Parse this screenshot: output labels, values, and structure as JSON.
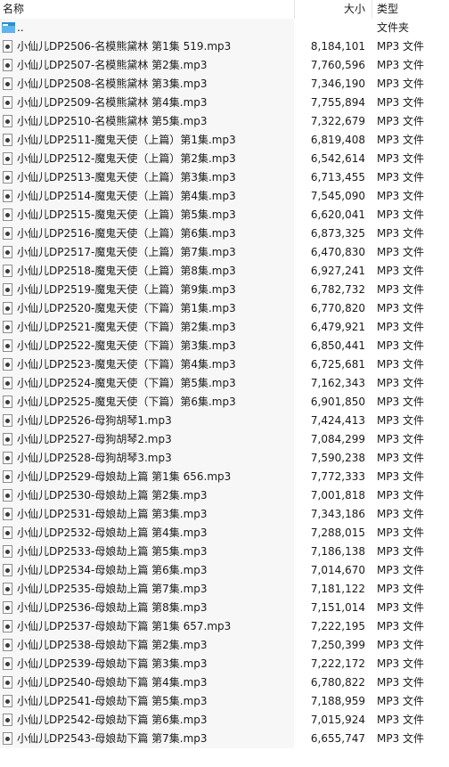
{
  "columns": {
    "name": "名称",
    "size": "大小",
    "type": "类型",
    "sort_indicator": "^"
  },
  "parent_row": {
    "name": "..",
    "size": "",
    "type": "文件夹",
    "icon": "folder-icon"
  },
  "files": [
    {
      "name": "小仙儿DP2506-名模熊黛林 第1集 519.mp3",
      "size": "8,184,101",
      "type": "MP3 文件"
    },
    {
      "name": "小仙儿DP2507-名模熊黛林 第2集.mp3",
      "size": "7,760,596",
      "type": "MP3 文件"
    },
    {
      "name": "小仙儿DP2508-名模熊黛林 第3集.mp3",
      "size": "7,346,190",
      "type": "MP3 文件"
    },
    {
      "name": "小仙儿DP2509-名模熊黛林 第4集.mp3",
      "size": "7,755,894",
      "type": "MP3 文件"
    },
    {
      "name": "小仙儿DP2510-名模熊黛林 第5集.mp3",
      "size": "7,322,679",
      "type": "MP3 文件"
    },
    {
      "name": "小仙儿DP2511-魔鬼天使（上篇）第1集.mp3",
      "size": "6,819,408",
      "type": "MP3 文件"
    },
    {
      "name": "小仙儿DP2512-魔鬼天使（上篇）第2集.mp3",
      "size": "6,542,614",
      "type": "MP3 文件"
    },
    {
      "name": "小仙儿DP2513-魔鬼天使（上篇）第3集.mp3",
      "size": "6,713,455",
      "type": "MP3 文件"
    },
    {
      "name": "小仙儿DP2514-魔鬼天使（上篇）第4集.mp3",
      "size": "7,545,090",
      "type": "MP3 文件"
    },
    {
      "name": "小仙儿DP2515-魔鬼天使（上篇）第5集.mp3",
      "size": "6,620,041",
      "type": "MP3 文件"
    },
    {
      "name": "小仙儿DP2516-魔鬼天使（上篇）第6集.mp3",
      "size": "6,873,325",
      "type": "MP3 文件"
    },
    {
      "name": "小仙儿DP2517-魔鬼天使（上篇）第7集.mp3",
      "size": "6,470,830",
      "type": "MP3 文件"
    },
    {
      "name": "小仙儿DP2518-魔鬼天使（上篇）第8集.mp3",
      "size": "6,927,241",
      "type": "MP3 文件"
    },
    {
      "name": "小仙儿DP2519-魔鬼天使（上篇）第9集.mp3",
      "size": "6,782,732",
      "type": "MP3 文件"
    },
    {
      "name": "小仙儿DP2520-魔鬼天使（下篇）第1集.mp3",
      "size": "6,770,820",
      "type": "MP3 文件"
    },
    {
      "name": "小仙儿DP2521-魔鬼天使（下篇）第2集.mp3",
      "size": "6,479,921",
      "type": "MP3 文件"
    },
    {
      "name": "小仙儿DP2522-魔鬼天使（下篇）第3集.mp3",
      "size": "6,850,441",
      "type": "MP3 文件"
    },
    {
      "name": "小仙儿DP2523-魔鬼天使（下篇）第4集.mp3",
      "size": "6,725,681",
      "type": "MP3 文件"
    },
    {
      "name": "小仙儿DP2524-魔鬼天使（下篇）第5集.mp3",
      "size": "7,162,343",
      "type": "MP3 文件"
    },
    {
      "name": "小仙儿DP2525-魔鬼天使（下篇）第6集.mp3",
      "size": "6,901,850",
      "type": "MP3 文件"
    },
    {
      "name": "小仙儿DP2526-母狗胡琴1.mp3",
      "size": "7,424,413",
      "type": "MP3 文件"
    },
    {
      "name": "小仙儿DP2527-母狗胡琴2.mp3",
      "size": "7,084,299",
      "type": "MP3 文件"
    },
    {
      "name": "小仙儿DP2528-母狗胡琴3.mp3",
      "size": "7,590,238",
      "type": "MP3 文件"
    },
    {
      "name": "小仙儿DP2529-母娘劫上篇 第1集 656.mp3",
      "size": "7,772,333",
      "type": "MP3 文件"
    },
    {
      "name": "小仙儿DP2530-母娘劫上篇 第2集.mp3",
      "size": "7,001,818",
      "type": "MP3 文件"
    },
    {
      "name": "小仙儿DP2531-母娘劫上篇 第3集.mp3",
      "size": "7,343,186",
      "type": "MP3 文件"
    },
    {
      "name": "小仙儿DP2532-母娘劫上篇 第4集.mp3",
      "size": "7,288,015",
      "type": "MP3 文件"
    },
    {
      "name": "小仙儿DP2533-母娘劫上篇 第5集.mp3",
      "size": "7,186,138",
      "type": "MP3 文件"
    },
    {
      "name": "小仙儿DP2534-母娘劫上篇 第6集.mp3",
      "size": "7,014,670",
      "type": "MP3 文件"
    },
    {
      "name": "小仙儿DP2535-母娘劫上篇 第7集.mp3",
      "size": "7,181,122",
      "type": "MP3 文件"
    },
    {
      "name": "小仙儿DP2536-母娘劫上篇 第8集.mp3",
      "size": "7,151,014",
      "type": "MP3 文件"
    },
    {
      "name": "小仙儿DP2537-母娘劫下篇 第1集 657.mp3",
      "size": "7,222,195",
      "type": "MP3 文件"
    },
    {
      "name": "小仙儿DP2538-母娘劫下篇 第2集.mp3",
      "size": "7,250,399",
      "type": "MP3 文件"
    },
    {
      "name": "小仙儿DP2539-母娘劫下篇 第3集.mp3",
      "size": "7,222,172",
      "type": "MP3 文件"
    },
    {
      "name": "小仙儿DP2540-母娘劫下篇 第4集.mp3",
      "size": "6,780,822",
      "type": "MP3 文件"
    },
    {
      "name": "小仙儿DP2541-母娘劫下篇 第5集.mp3",
      "size": "7,188,959",
      "type": "MP3 文件"
    },
    {
      "name": "小仙儿DP2542-母娘劫下篇 第6集.mp3",
      "size": "7,015,924",
      "type": "MP3 文件"
    },
    {
      "name": "小仙儿DP2543-母娘劫下篇 第7集.mp3",
      "size": "6,655,747",
      "type": "MP3 文件"
    }
  ]
}
